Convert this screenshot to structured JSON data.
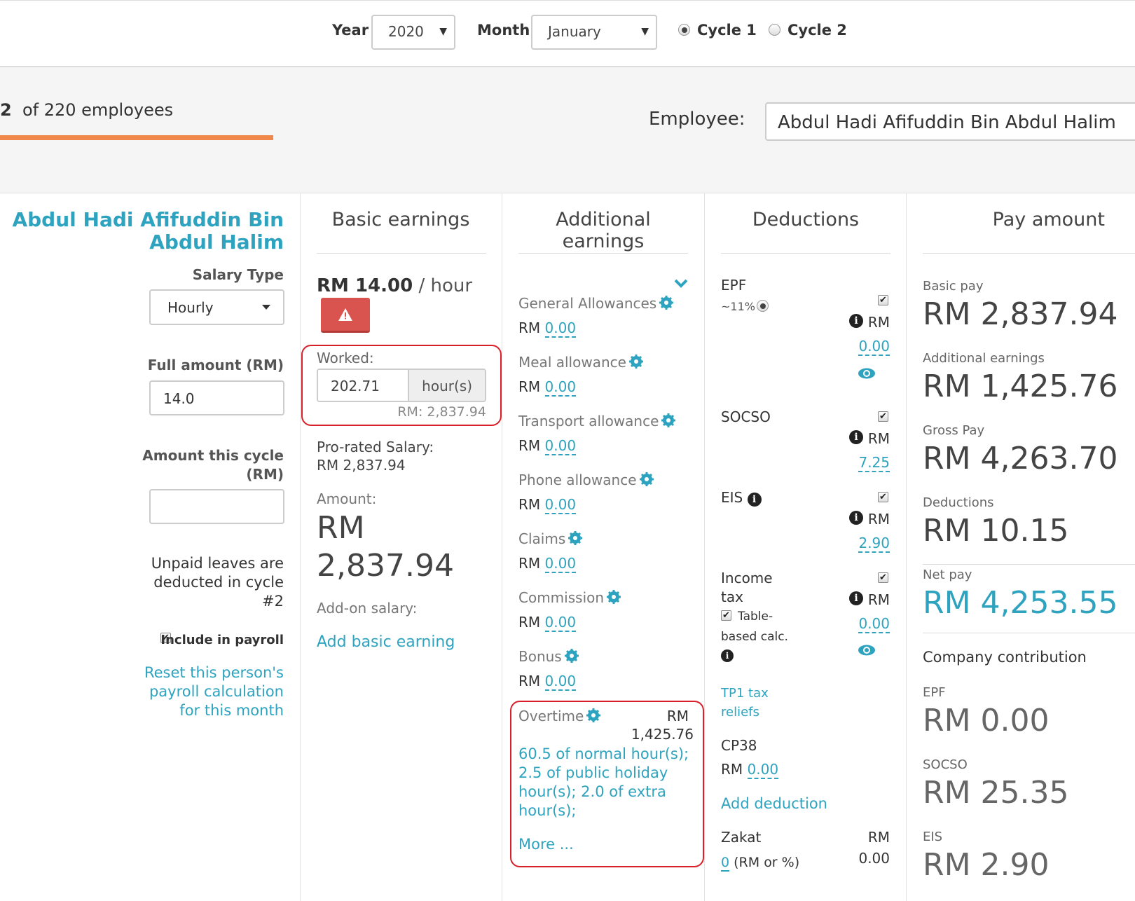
{
  "filters": {
    "year_label": "Year",
    "year_value": "2020",
    "month_label": "Month",
    "month_value": "January",
    "cycle1_label": "Cycle 1",
    "cycle2_label": "Cycle 2",
    "selected_cycle": "Cycle 1"
  },
  "header": {
    "employee_count_prefix": "2",
    "employee_count_text": "of 220 employees",
    "employee_label": "Employee:",
    "employee_value": "Abdul Hadi Afifuddin Bin Abdul Halim"
  },
  "sidebar": {
    "name_line1": "Abdul Hadi Afifuddin Bin",
    "name_line2": "Abdul Halim",
    "salary_type_label": "Salary Type",
    "salary_type_value": "Hourly",
    "full_amount_label": "Full amount (RM)",
    "full_amount_value": "14.0",
    "amount_cycle_label_1": "Amount this cycle",
    "amount_cycle_label_2": "(RM)",
    "amount_cycle_value": "",
    "unpaid_line1": "Unpaid leaves are",
    "unpaid_line2": "deducted in cycle",
    "unpaid_line3": "#2",
    "include_payroll_label": "Include in payroll",
    "reset_line1": "Reset this person's",
    "reset_line2": "payroll calculation",
    "reset_line3": "for this month"
  },
  "basic": {
    "title": "Basic earnings",
    "rate": "RM 14.00",
    "rate_unit": "/ hour",
    "worked_label": "Worked:",
    "worked_value": "202.71",
    "worked_unit": "hour(s)",
    "worked_rm": "RM: 2,837.94",
    "prorated_label": "Pro-rated Salary:",
    "prorated_value": "RM 2,837.94",
    "amount_label": "Amount:",
    "amount_currency": "RM",
    "amount_value": "2,837.94",
    "addon_label": "Add-on salary:",
    "add_link": "Add basic earning"
  },
  "additional": {
    "title": "Additional earnings",
    "items": [
      {
        "label": "General Allowances",
        "currency": "RM",
        "value": "0.00"
      },
      {
        "label": "Meal allowance",
        "currency": "RM",
        "value": "0.00"
      },
      {
        "label": "Transport allowance",
        "currency": "RM",
        "value": "0.00"
      },
      {
        "label": "Phone allowance",
        "currency": "RM",
        "value": "0.00"
      },
      {
        "label": "Claims",
        "currency": "RM",
        "value": "0.00"
      },
      {
        "label": "Commission",
        "currency": "RM",
        "value": "0.00"
      },
      {
        "label": "Bonus",
        "currency": "RM",
        "value": "0.00"
      }
    ],
    "overtime_label": "Overtime",
    "overtime_currency": "RM",
    "overtime_value": "1,425.76",
    "overtime_line1": "60.5 of normal hour(s);",
    "overtime_line2": "2.5 of public holiday",
    "overtime_line3": "hour(s); 2.0 of extra",
    "overtime_line4": "hour(s);",
    "more_link": "More ..."
  },
  "deductions": {
    "title": "Deductions",
    "epf_label": "EPF",
    "epf_rate": "~11%",
    "epf_currency": "RM",
    "epf_value": "0.00",
    "socso_label": "SOCSO",
    "socso_currency": "RM",
    "socso_value": "7.25",
    "eis_label": "EIS",
    "eis_currency": "RM",
    "eis_value": "2.90",
    "income_tax_line1": "Income",
    "income_tax_line2": "tax",
    "table_calc_line1": "Table-",
    "table_calc_line2": "based calc.",
    "income_tax_currency": "RM",
    "income_tax_value": "0.00",
    "tp1_line1": "TP1 tax",
    "tp1_line2": "reliefs",
    "cp38_label": "CP38",
    "cp38_currency": "RM",
    "cp38_value": "0.00",
    "add_deduction": "Add deduction",
    "zakat_label": "Zakat",
    "zakat_input": "0",
    "zakat_hint": "(RM or %)",
    "zakat_currency": "RM",
    "zakat_value": "0.00"
  },
  "pay": {
    "title": "Pay amount",
    "basic_label": "Basic pay",
    "basic_value": "RM 2,837.94",
    "additional_label": "Additional earnings",
    "additional_value": "RM 1,425.76",
    "gross_label": "Gross Pay",
    "gross_value": "RM 4,263.70",
    "deductions_label": "Deductions",
    "deductions_value": "RM 10.15",
    "net_label": "Net pay",
    "net_value": "RM 4,253.55",
    "company_label": "Company contribution",
    "c_epf_label": "EPF",
    "c_epf_value": "RM 0.00",
    "c_socso_label": "SOCSO",
    "c_socso_value": "RM 25.35",
    "c_eis_label": "EIS",
    "c_eis_value": "RM 2.90"
  },
  "colors": {
    "accent": "#2ea3bf",
    "progress": "#f0884a",
    "warning": "#d9534f",
    "highlight": "#d9202a"
  }
}
